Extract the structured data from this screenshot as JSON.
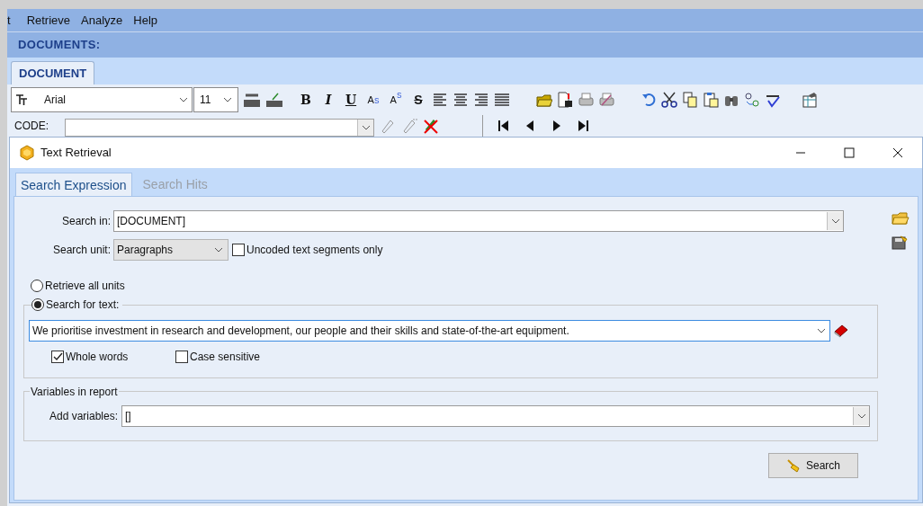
{
  "menu": [
    "t",
    "Retrieve",
    "Analyze",
    "Help"
  ],
  "documents_bar": {
    "title": "DOCUMENTS:"
  },
  "document_tabs": [
    {
      "label": "DOCUMENT",
      "selected": true
    }
  ],
  "toolbar": {
    "font": "Arial",
    "size": "11",
    "format_buttons": [
      {
        "kind": "bold",
        "label": "B"
      },
      {
        "kind": "italic",
        "label": "I"
      },
      {
        "kind": "underline",
        "label": "U"
      },
      {
        "kind": "subscript",
        "label": "A$_{S}$"
      },
      {
        "kind": "superscript",
        "label": "A$^{S}$"
      },
      {
        "kind": "strike",
        "label": "S"
      }
    ]
  },
  "code_row": {
    "label": "CODE:"
  },
  "dialog": {
    "title": "Text Retrieval",
    "tabs": [
      {
        "label": "Search Expression",
        "selected": true
      },
      {
        "label": "Search Hits",
        "selected": false
      }
    ],
    "search_in": {
      "label": "Search in:",
      "value": "[DOCUMENT]"
    },
    "search_unit": {
      "label": "Search unit:",
      "value": "Paragraphs"
    },
    "uncoded_only": {
      "label": "Uncoded text segments only",
      "checked": false
    },
    "mode_options": [
      {
        "label": "Retrieve all units",
        "selected": false
      },
      {
        "label": "Search for text:",
        "selected": true
      }
    ],
    "search_text": {
      "value": "We prioritise investment in research and development, our people and their skills and state-of-the-art equipment."
    },
    "whole_words": {
      "label": "Whole words",
      "checked": true
    },
    "case_sensitive": {
      "label": "Case sensitive",
      "checked": false
    },
    "variables": {
      "title": "Variables in report",
      "label": "Add variables:",
      "value": "[]"
    },
    "search_button": "Search"
  }
}
